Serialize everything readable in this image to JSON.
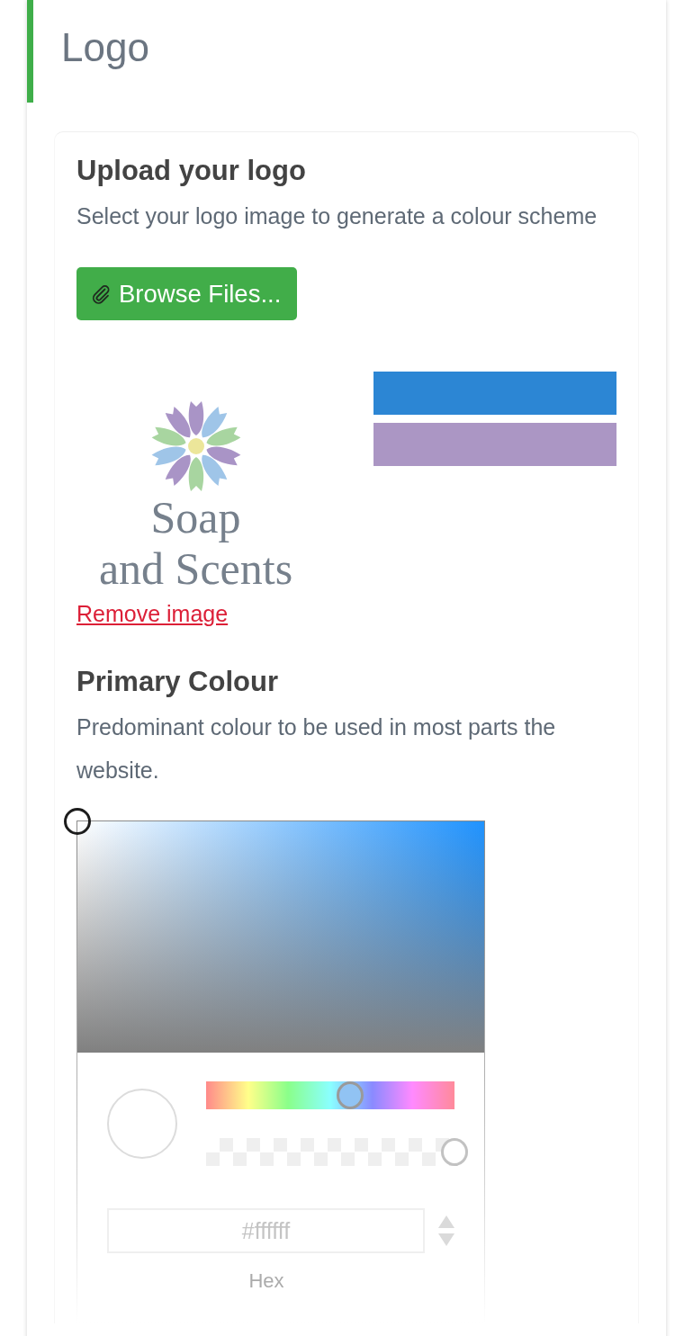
{
  "section": {
    "title": "Logo"
  },
  "upload": {
    "heading": "Upload your logo",
    "description": "Select your logo image to generate a colour scheme",
    "browse_button": "Browse Files..."
  },
  "logo_preview": {
    "text_lines": [
      "Soap",
      "and Scents"
    ]
  },
  "palette": [
    {
      "color": "#2c86d4"
    },
    {
      "color": "#ab96c4"
    }
  ],
  "remove_link": "Remove image",
  "primary_colour": {
    "heading": "Primary Colour",
    "description": "Predominant colour to be used in most parts the website.",
    "picker": {
      "color_area": {
        "saturation": {
          "level": 0
        },
        "shade": {
          "level": 0
        }
      },
      "hue_slider": {
        "level": 0.58
      },
      "alpha_slider": {
        "level": 1
      },
      "hex_field": {
        "value": "#ffffff",
        "label": "Hex"
      }
    }
  }
}
